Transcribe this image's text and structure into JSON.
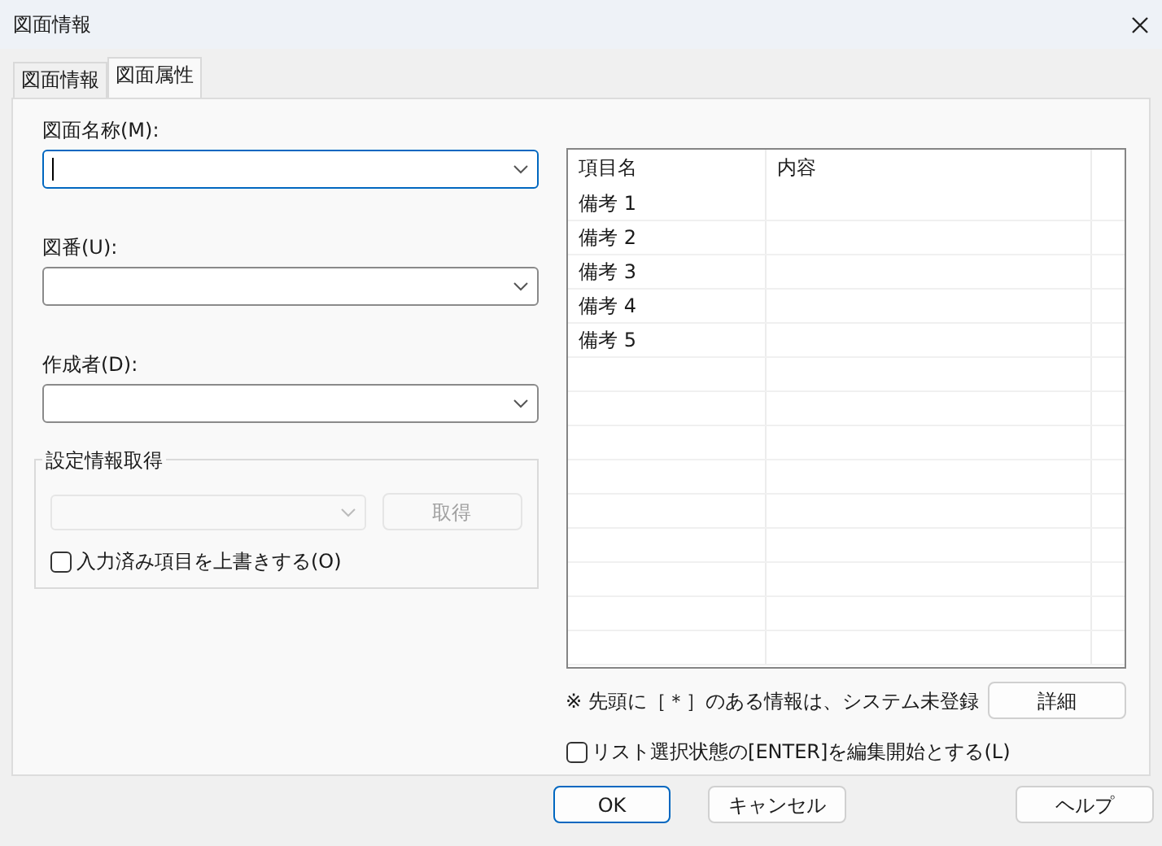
{
  "window": {
    "title": "図面情報"
  },
  "tabs": [
    {
      "label": "図面情報",
      "selected": false
    },
    {
      "label": "図面属性",
      "selected": true
    }
  ],
  "fields": [
    {
      "label": "図面名称(M):",
      "focused": true
    },
    {
      "label": "図番(U):",
      "focused": false
    },
    {
      "label": "作成者(D):",
      "focused": false
    }
  ],
  "settings_group": {
    "title": "設定情報取得",
    "combo_disabled": true,
    "button": {
      "label": "取得",
      "disabled": true
    },
    "checkbox": {
      "label": "入力済み項目を上書きする(O)",
      "checked": false
    }
  },
  "table": {
    "columns": [
      "項目名",
      "内容"
    ],
    "rows": [
      {
        "item": "備考 1"
      },
      {
        "item": "備考 2"
      },
      {
        "item": "備考 3"
      },
      {
        "item": "備考 4"
      },
      {
        "item": "備考 5"
      }
    ]
  },
  "note": "※ 先頭に［＊］のある情報は、システム未登録",
  "detail_button": "詳細",
  "enter_checkbox": {
    "label": "リスト選択状態の[ENTER]を編集開始とする(L)",
    "checked": false
  },
  "buttons": [
    {
      "label": "OK",
      "default": true
    },
    {
      "label": "キャンセル",
      "default": false
    },
    {
      "label": "ヘルプ",
      "default": false
    }
  ]
}
